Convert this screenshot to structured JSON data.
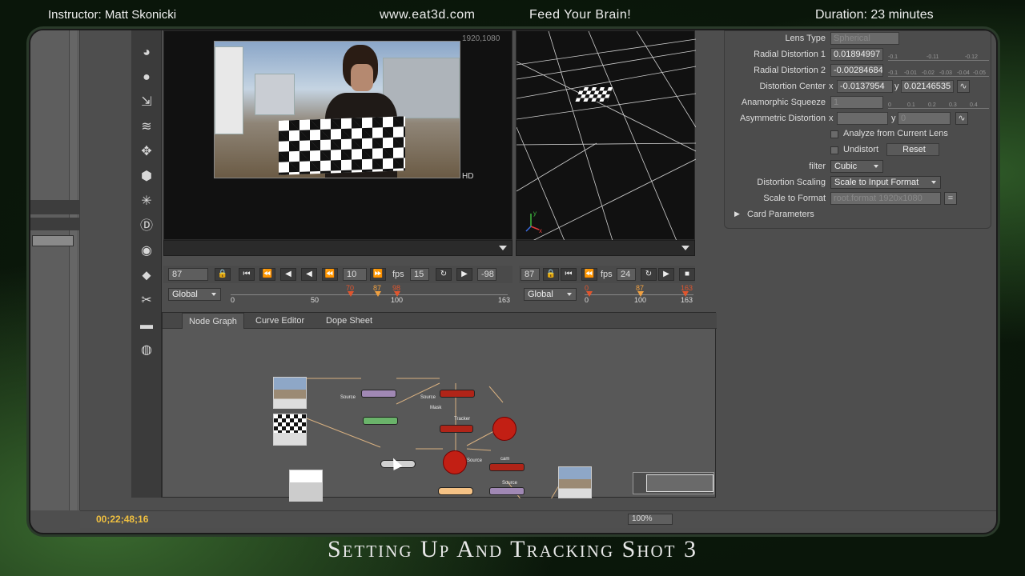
{
  "top_bar": {
    "instructor": "Instructor: Matt Skonicki",
    "site": "www.eat3d.com",
    "tagline": "Feed Your Brain!",
    "duration": "Duration: 23 minutes"
  },
  "bottom_title": "Setting Up And Tracking Shot 3",
  "viewer1": {
    "resolution": "1920,1080",
    "format_label": "HD",
    "frame_field": "87",
    "step_field": "10",
    "fps_label": "fps",
    "fps_value": "15",
    "offset_value": "-98",
    "scope_dropdown": "Global",
    "timeline": {
      "in_mark": "70",
      "current": "87",
      "out_mark": "98",
      "ticks": [
        "0",
        "50",
        "100",
        "163"
      ]
    }
  },
  "viewer2": {
    "frame_field": "87",
    "fps_label": "fps",
    "fps_value": "24",
    "scope_dropdown": "Global",
    "axis_y": "y",
    "axis_x": "x",
    "timeline": {
      "in_mark": "0",
      "current": "87",
      "out_mark": "163",
      "ticks": [
        "0",
        "100",
        "163"
      ]
    }
  },
  "properties": {
    "lens_type_label": "Lens Type",
    "lens_type_value": "Spherical",
    "radial1_label": "Radial Distortion 1",
    "radial1_value": "0.01894997",
    "radial2_label": "Radial Distortion 2",
    "radial2_value": "-0.00284684",
    "center_label": "Distortion Center",
    "center_x_label": "x",
    "center_x": "-0.0137954",
    "center_y_label": "y",
    "center_y": "0.02146535",
    "anamorphic_label": "Anamorphic Squeeze",
    "anamorphic_value": "1",
    "asym_label": "Asymmetric Distortion",
    "asym_x_label": "x",
    "asym_x": "",
    "asym_y_label": "y",
    "asym_y": "0",
    "analyze_label": "Analyze from Current Lens",
    "undistort_label": "Undistort",
    "reset_label": "Reset",
    "filter_label": "filter",
    "filter_value": "Cubic",
    "scaling_label": "Distortion Scaling",
    "scaling_value": "Scale to Input Format",
    "scale_format_label": "Scale to Format",
    "scale_format_value": "root.format 1920x1080",
    "card_params_label": "Card Parameters",
    "ruler1": [
      "-0.1",
      "-0.11",
      "-0.12"
    ],
    "ruler2": [
      "-0.1",
      "-0.01",
      "-0.02",
      "-0.03",
      "-0.04",
      "-0.05"
    ],
    "ruler3": [
      "0",
      "0.1",
      "0.2",
      "0.3",
      "0.4"
    ]
  },
  "node_graph": {
    "tabs": [
      "Node Graph",
      "Curve Editor",
      "Dope Sheet"
    ],
    "active_tab": "Node Graph",
    "edge_labels": [
      "Source",
      "Source",
      "Mask",
      "Tracker",
      "Source",
      "cam",
      "Source"
    ]
  },
  "status_bar": {
    "timecode": "00;22;48;16",
    "zoom": "100%"
  }
}
